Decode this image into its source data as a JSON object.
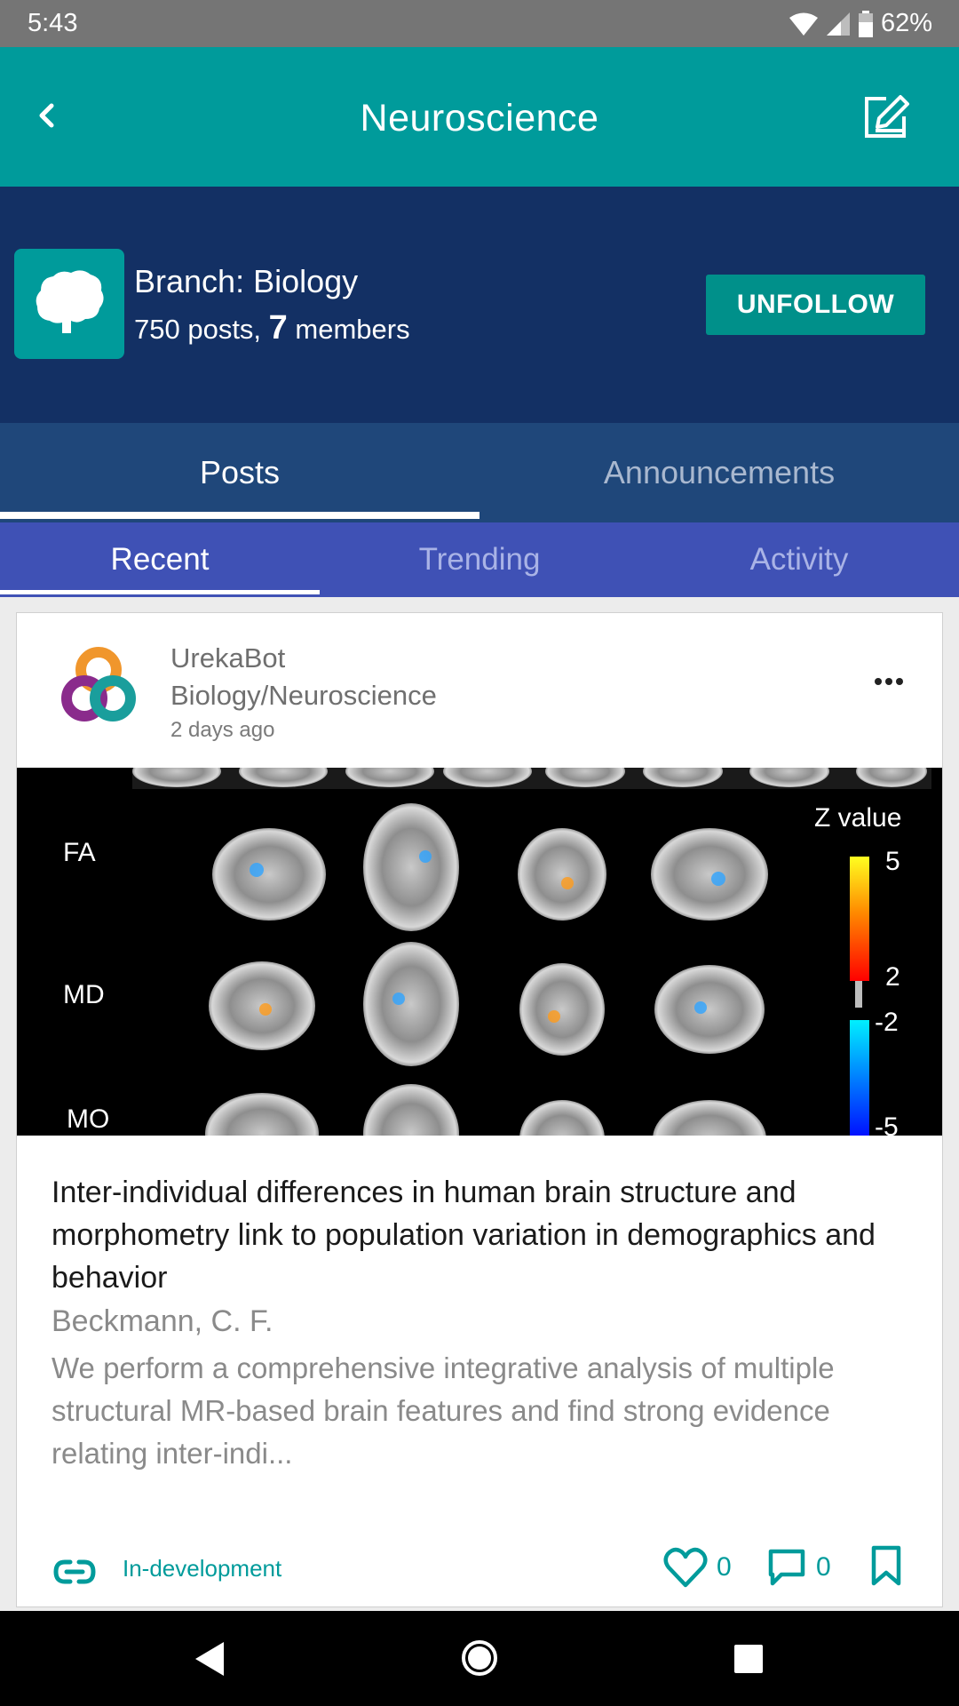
{
  "status_bar": {
    "time": "5:43",
    "battery": "62%"
  },
  "app_bar": {
    "title": "Neuroscience"
  },
  "branch": {
    "name": "Branch: Biology",
    "posts_text": "750 posts, ",
    "members_count": "7",
    "members_text": " members",
    "unfollow_label": "UNFOLLOW"
  },
  "main_tabs": [
    {
      "label": "Posts",
      "active": true
    },
    {
      "label": "Announcements",
      "active": false
    }
  ],
  "sub_tabs": [
    {
      "label": "Recent",
      "active": true
    },
    {
      "label": "Trending",
      "active": false
    },
    {
      "label": "Activity",
      "active": false
    }
  ],
  "post": {
    "author": "UrekaBot",
    "category": "Biology/Neuroscience",
    "timestamp": "2 days ago",
    "image": {
      "row_labels": [
        "FA",
        "MD",
        "MO"
      ],
      "legend_title": "Z value",
      "legend_ticks": [
        "5",
        "2",
        "-2",
        "-5"
      ]
    },
    "title": "Inter-individual differences in human brain structure and morphometry link to population variation in demographics and behavior",
    "paper_author": "Beckmann, C. F.",
    "abstract": "We perform a comprehensive integrative analysis of multiple structural MR-based brain features and find strong evidence relating inter-indi...",
    "tag": "In-development",
    "likes": "0",
    "comments": "0"
  },
  "colors": {
    "teal": "#009b9b",
    "navy": "#133064",
    "tab_blue": "#1f477a",
    "indigo": "#3f51b5"
  }
}
